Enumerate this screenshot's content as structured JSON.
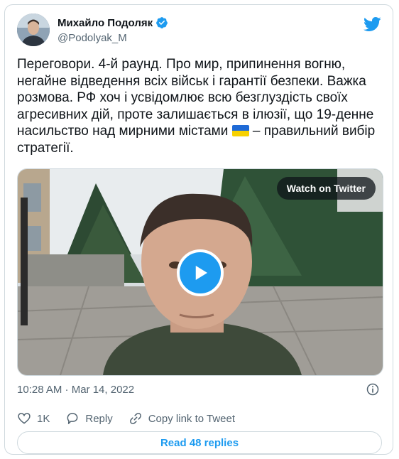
{
  "author": {
    "name": "Михайло Подоляк",
    "handle": "@Podolyak_M",
    "verified": true
  },
  "tweet": {
    "text": "Переговори. 4-й раунд. Про мир, припинення вогню, негайне відведення всіх військ і гарантії безпеки. Важка розмова. РФ хоч і усвідомлює всю безглуздість своїх агресивних дій, проте залишається в ілюзії, що 19-денне насильство над мирними містами 🇺🇦 – правильний вибір стратегії.",
    "text_parts": [
      "Переговори. 4-й раунд. Про мир, припинення вогню, негайне відведення всіх військ і гарантії безпеки. Важка розмова. РФ хоч і усвідомлює всю безглуздість своїх агресивних дій, проте залишається в ілюзії, що 19-денне насильство над мирними містами ",
      " – правильний вибір стратегії."
    ],
    "flag_icon": "ukraine-flag-icon"
  },
  "media": {
    "watch_label": "Watch on Twitter",
    "play_icon": "play-icon"
  },
  "meta": {
    "timestamp": "10:28 AM · Mar 14, 2022",
    "info_icon": "info-icon"
  },
  "actions": {
    "like_count": "1K",
    "reply_label": "Reply",
    "copy_label": "Copy link to Tweet"
  },
  "read_replies_label": "Read 48 replies",
  "colors": {
    "accent": "#1d9bf0",
    "text": "#0f1419",
    "secondary": "#536471",
    "border": "#cfd9de"
  }
}
